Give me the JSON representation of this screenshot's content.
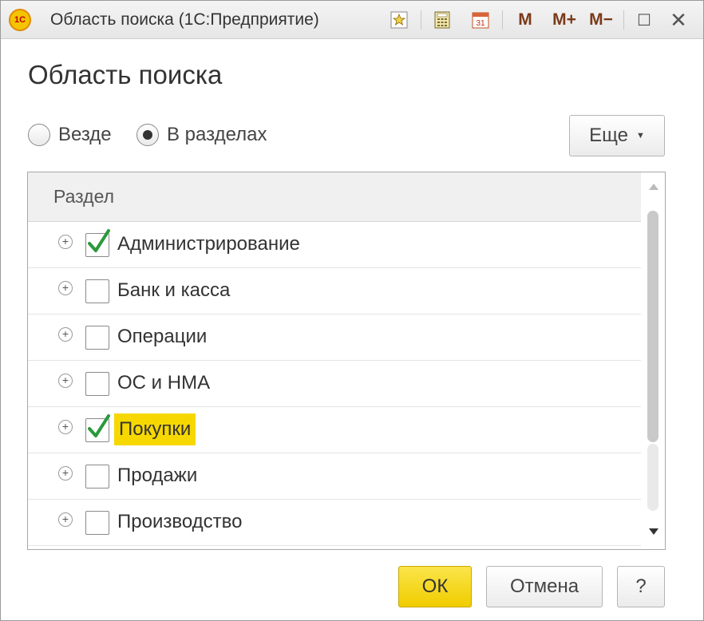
{
  "titlebar": {
    "logo_text": "1С",
    "title": "Область поиска  (1С:Предприятие)",
    "icons": [
      "favorite-star-icon",
      "calculator-icon",
      "calendar-icon"
    ],
    "calendar_day": "31",
    "memory_buttons": [
      "M",
      "M+",
      "M−"
    ],
    "maximize": "☐",
    "close": "✕"
  },
  "page": {
    "title": "Область поиска"
  },
  "scope": {
    "options": [
      {
        "label": "Везде",
        "selected": false
      },
      {
        "label": "В разделах",
        "selected": true
      }
    ],
    "more_label": "Еще"
  },
  "table": {
    "column_header": "Раздел",
    "rows": [
      {
        "label": "Администрирование",
        "checked": true,
        "highlighted": false
      },
      {
        "label": "Банк и касса",
        "checked": false,
        "highlighted": false
      },
      {
        "label": "Операции",
        "checked": false,
        "highlighted": false
      },
      {
        "label": "ОС и НМА",
        "checked": false,
        "highlighted": false
      },
      {
        "label": "Покупки",
        "checked": true,
        "highlighted": true
      },
      {
        "label": "Продажи",
        "checked": false,
        "highlighted": false
      },
      {
        "label": "Производство",
        "checked": false,
        "highlighted": false
      }
    ]
  },
  "buttons": {
    "ok": "ОК",
    "cancel": "Отмена",
    "help": "?"
  },
  "colors": {
    "highlight": "#f6d800",
    "checkmark": "#2a9a3a",
    "ok_button": "#f0cc00"
  }
}
